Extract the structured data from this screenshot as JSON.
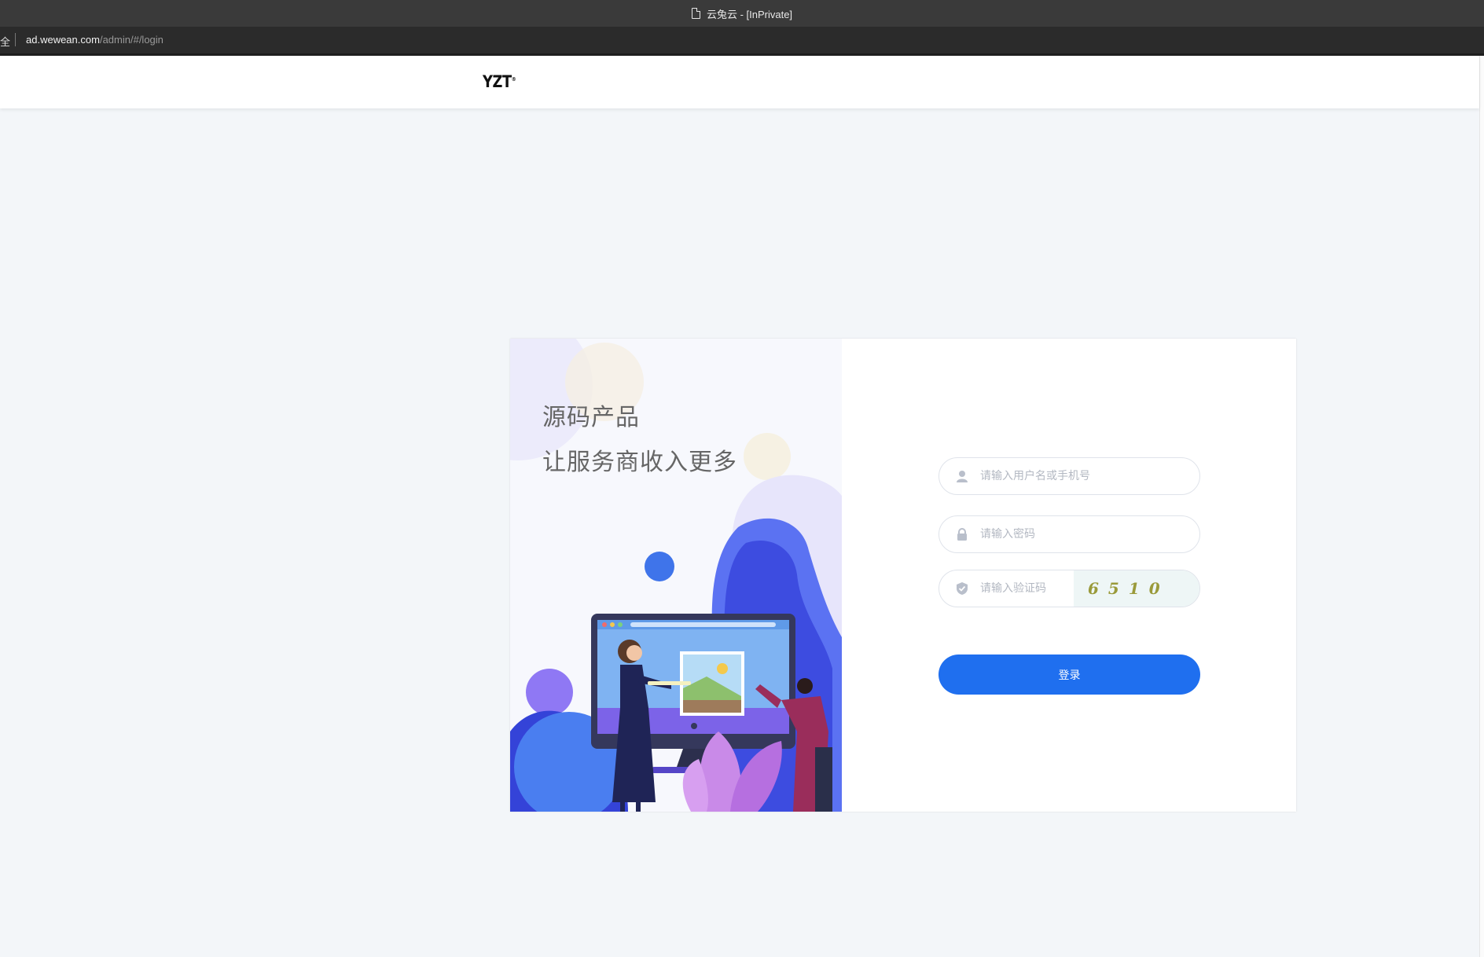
{
  "browser": {
    "window_title": "云兔云 - [InPrivate]",
    "security_label": "全",
    "url_host": "ad.wewean.com",
    "url_path": "/admin/#/login"
  },
  "header": {
    "logo_text": "YZT",
    "logo_mark": "®"
  },
  "illustration": {
    "slogan_line1": "源码产品",
    "slogan_line2": "让服务商收入更多"
  },
  "login": {
    "username_placeholder": "请输入用户名或手机号",
    "password_placeholder": "请输入密码",
    "captcha_placeholder": "请输入验证码",
    "captcha_text": "6510",
    "submit_label": "登录"
  },
  "colors": {
    "accent": "#1f6fef",
    "page_background": "#f3f6f9",
    "illustration_blue": "#3b4fe0",
    "illustration_purple": "#8a6cf5"
  }
}
